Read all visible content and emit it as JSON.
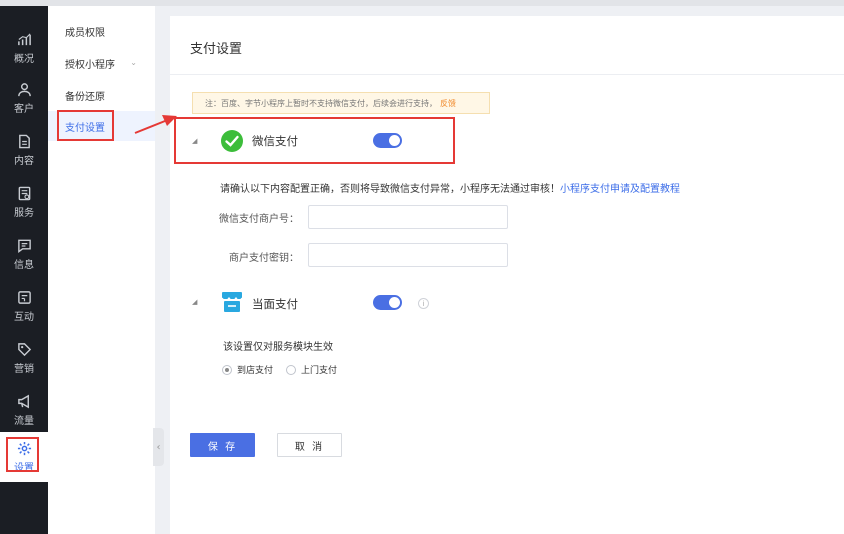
{
  "sidebar": {
    "items": [
      {
        "label": "概况",
        "icon": "chart-icon"
      },
      {
        "label": "客户",
        "icon": "user-icon"
      },
      {
        "label": "内容",
        "icon": "document-icon"
      },
      {
        "label": "服务",
        "icon": "service-icon"
      },
      {
        "label": "信息",
        "icon": "message-icon"
      },
      {
        "label": "互动",
        "icon": "interact-icon"
      },
      {
        "label": "营销",
        "icon": "tag-icon"
      },
      {
        "label": "流量",
        "icon": "megaphone-icon"
      },
      {
        "label": "设置",
        "icon": "gear-icon",
        "active": true
      }
    ]
  },
  "submenu": {
    "items": [
      {
        "label": "成员权限"
      },
      {
        "label": "授权小程序"
      },
      {
        "label": "备份还原"
      },
      {
        "label": "支付设置",
        "active": true
      }
    ]
  },
  "main": {
    "title": "支付设置",
    "notice": {
      "text": "注：百度、字节小程序上暂时不支持微信支付，后续会进行支持，",
      "link": "反馈"
    },
    "wechat_pay": {
      "label": "微信支付",
      "enabled": true,
      "hint": "请确认以下内容配置正确，否则将导致微信支付异常，小程序无法通过审核！",
      "hint_link": "小程序支付申请及配置教程",
      "merchant_id_label": "微信支付商户号：",
      "merchant_id_value": "",
      "merchant_key_label": "商户支付密钥：",
      "merchant_key_value": ""
    },
    "face_pay": {
      "label": "当面支付",
      "enabled": true,
      "info_icon": "info-icon",
      "scope_text": "该设置仅对服务模块生效",
      "options": [
        {
          "label": "到店支付",
          "checked": true
        },
        {
          "label": "上门支付",
          "checked": false
        }
      ]
    },
    "buttons": {
      "save": "保 存",
      "cancel": "取 消"
    }
  },
  "colors": {
    "accent": "#4a6fe3",
    "sidebar_bg": "#1b1e24",
    "annotation": "#e53935",
    "wechat_green": "#3cbd3a"
  }
}
